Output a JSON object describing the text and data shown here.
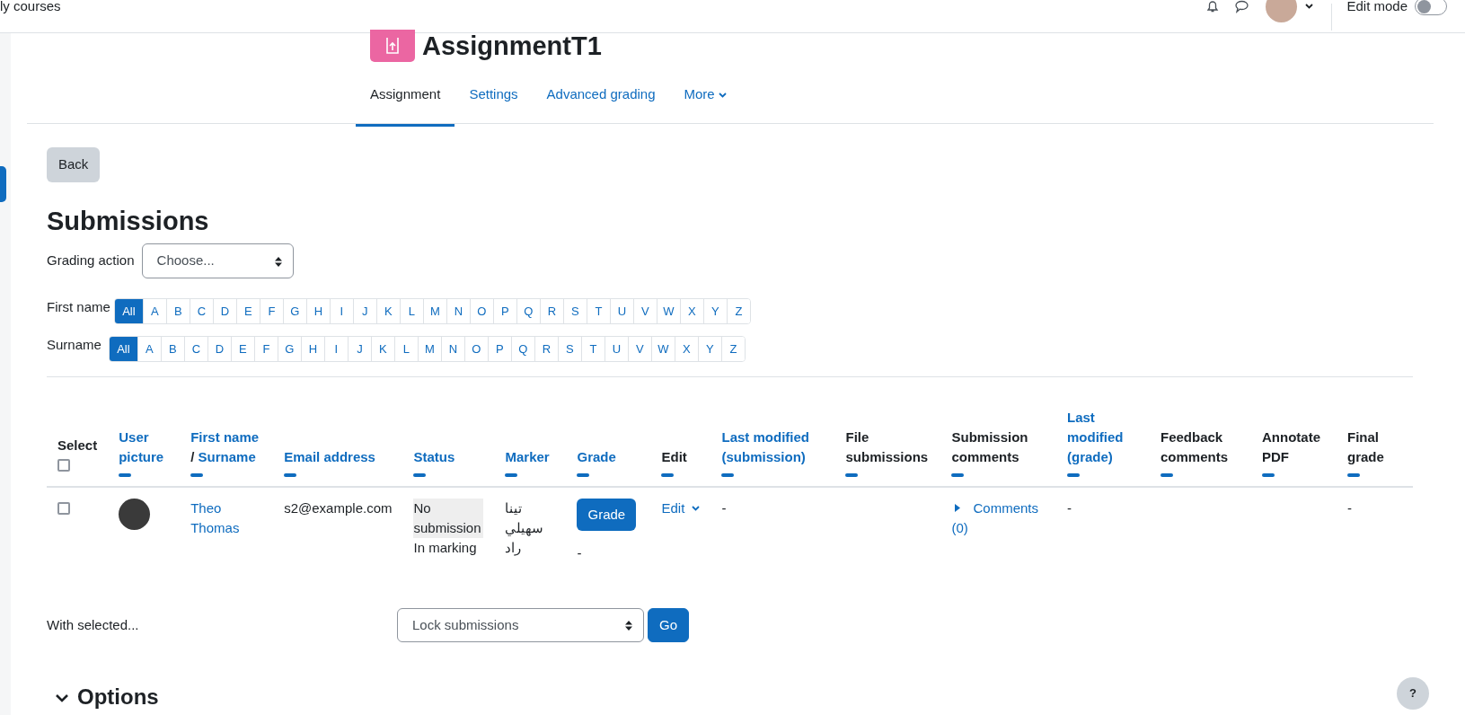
{
  "topbar": {
    "site_link": "ly courses",
    "edit_mode": {
      "label": "Edit mode",
      "on": false
    }
  },
  "header": {
    "title": "AssignmentT1"
  },
  "tabs": [
    {
      "label": "Assignment",
      "selected": true,
      "kind": "tab"
    },
    {
      "label": "Settings",
      "selected": false,
      "kind": "tab"
    },
    {
      "label": "Advanced grading",
      "selected": false,
      "kind": "tab"
    },
    {
      "label": "More",
      "selected": false,
      "kind": "menu"
    }
  ],
  "back_button": "Back",
  "heading": "Submissions",
  "grading_action": {
    "label": "Grading action",
    "value": "Choose..."
  },
  "initials_bars": [
    {
      "label": "First name",
      "letters": [
        {
          "label": "All",
          "selected": true
        },
        {
          "label": "A",
          "selected": false
        },
        {
          "label": "B",
          "selected": false
        },
        {
          "label": "C",
          "selected": false
        },
        {
          "label": "D",
          "selected": false
        },
        {
          "label": "E",
          "selected": false
        },
        {
          "label": "F",
          "selected": false
        },
        {
          "label": "G",
          "selected": false
        },
        {
          "label": "H",
          "selected": false
        },
        {
          "label": "I",
          "selected": false
        },
        {
          "label": "J",
          "selected": false
        },
        {
          "label": "K",
          "selected": false
        },
        {
          "label": "L",
          "selected": false
        },
        {
          "label": "M",
          "selected": false
        },
        {
          "label": "N",
          "selected": false
        },
        {
          "label": "O",
          "selected": false
        },
        {
          "label": "P",
          "selected": false
        },
        {
          "label": "Q",
          "selected": false
        },
        {
          "label": "R",
          "selected": false
        },
        {
          "label": "S",
          "selected": false
        },
        {
          "label": "T",
          "selected": false
        },
        {
          "label": "U",
          "selected": false
        },
        {
          "label": "V",
          "selected": false
        },
        {
          "label": "W",
          "selected": false
        },
        {
          "label": "X",
          "selected": false
        },
        {
          "label": "Y",
          "selected": false
        },
        {
          "label": "Z",
          "selected": false
        }
      ]
    },
    {
      "label": "Surname",
      "letters": [
        {
          "label": "All",
          "selected": true
        },
        {
          "label": "A",
          "selected": false
        },
        {
          "label": "B",
          "selected": false
        },
        {
          "label": "C",
          "selected": false
        },
        {
          "label": "D",
          "selected": false
        },
        {
          "label": "E",
          "selected": false
        },
        {
          "label": "F",
          "selected": false
        },
        {
          "label": "G",
          "selected": false
        },
        {
          "label": "H",
          "selected": false
        },
        {
          "label": "I",
          "selected": false
        },
        {
          "label": "J",
          "selected": false
        },
        {
          "label": "K",
          "selected": false
        },
        {
          "label": "L",
          "selected": false
        },
        {
          "label": "M",
          "selected": false
        },
        {
          "label": "N",
          "selected": false
        },
        {
          "label": "O",
          "selected": false
        },
        {
          "label": "P",
          "selected": false
        },
        {
          "label": "Q",
          "selected": false
        },
        {
          "label": "R",
          "selected": false
        },
        {
          "label": "S",
          "selected": false
        },
        {
          "label": "T",
          "selected": false
        },
        {
          "label": "U",
          "selected": false
        },
        {
          "label": "V",
          "selected": false
        },
        {
          "label": "W",
          "selected": false
        },
        {
          "label": "X",
          "selected": false
        },
        {
          "label": "Y",
          "selected": false
        },
        {
          "label": "Z",
          "selected": false
        }
      ]
    }
  ],
  "table": {
    "columns": [
      {
        "kind": "select",
        "label": "Select",
        "checked": false
      },
      {
        "kind": "link",
        "label": "User picture"
      },
      {
        "kind": "pair",
        "label": "First name",
        "separator": "/",
        "label2": "Surname"
      },
      {
        "kind": "link",
        "label": "Email address"
      },
      {
        "kind": "link",
        "label": "Status"
      },
      {
        "kind": "link",
        "label": "Marker"
      },
      {
        "kind": "link",
        "label": "Grade"
      },
      {
        "kind": "plain",
        "label": "Edit"
      },
      {
        "kind": "link",
        "label": "Last modified (submission)"
      },
      {
        "kind": "plain",
        "label": "File submissions"
      },
      {
        "kind": "plain",
        "label": "Submission comments"
      },
      {
        "kind": "link",
        "label": "Last modified (grade)"
      },
      {
        "kind": "plain",
        "label": "Feedback comments"
      },
      {
        "kind": "plain",
        "label": "Annotate PDF"
      },
      {
        "kind": "plain",
        "label": "Final grade"
      }
    ],
    "rows": [
      {
        "checked": false,
        "name": "Theo Thomas",
        "email": "s2@example.com",
        "status": "No submission",
        "marking_state": "In marking",
        "marker": "تينا سهيلي راد",
        "grade_button": "Grade",
        "grade": "-",
        "edit": "Edit",
        "last_modified_submission": "-",
        "comments": "Comments (0)",
        "last_modified_grade": "-",
        "final_grade": "-"
      }
    ]
  },
  "bulk": {
    "label": "With selected...",
    "value": "Lock submissions",
    "button": "Go"
  },
  "options": {
    "label": "Options",
    "expanded": true
  },
  "help_button": "?"
}
